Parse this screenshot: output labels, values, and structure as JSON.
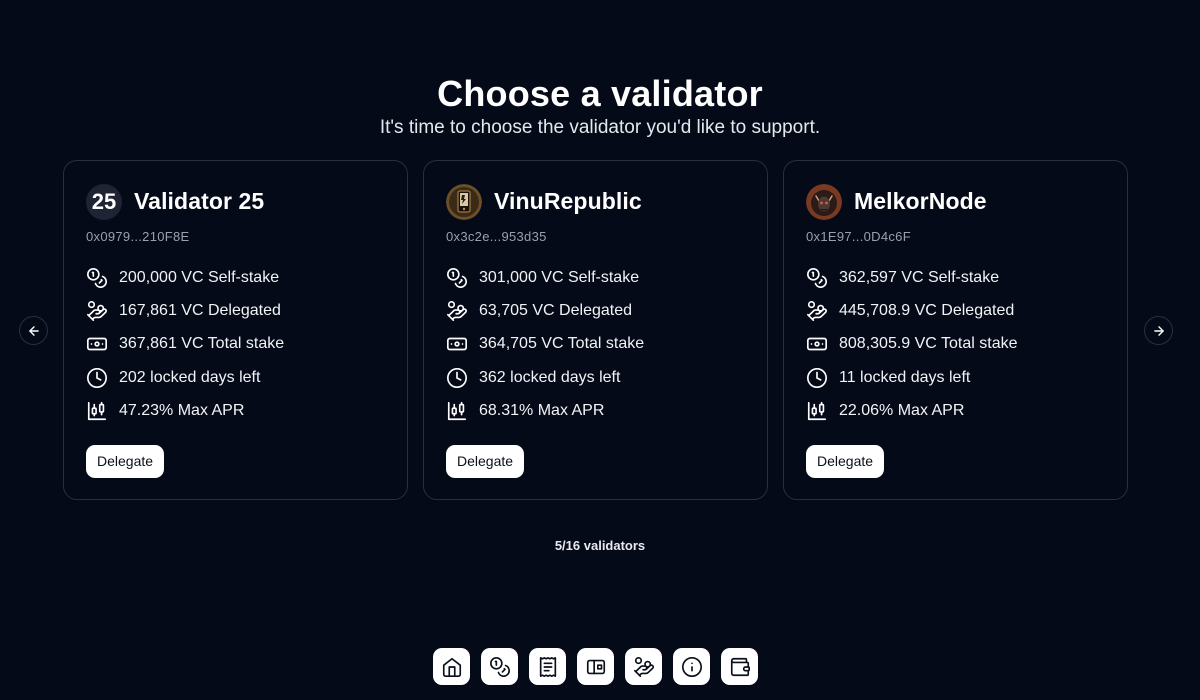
{
  "header": {
    "title": "Choose a validator",
    "subtitle": "It's time to choose the validator you'd like to support."
  },
  "validators": [
    {
      "avatar": "25",
      "avatar_type": "number",
      "name": "Validator 25",
      "address": "0x0979...210F8E",
      "self_stake": "200,000 VC Self-stake",
      "delegated": "167,861 VC Delegated",
      "total_stake": "367,861 VC Total stake",
      "locked_days": "202 locked days left",
      "max_apr": "47.23% Max APR",
      "button": "Delegate"
    },
    {
      "avatar": "",
      "avatar_type": "image",
      "name": "VinuRepublic",
      "address": "0x3c2e...953d35",
      "self_stake": "301,000 VC Self-stake",
      "delegated": "63,705 VC Delegated",
      "total_stake": "364,705 VC Total stake",
      "locked_days": "362 locked days left",
      "max_apr": "68.31% Max APR",
      "button": "Delegate"
    },
    {
      "avatar": "",
      "avatar_type": "image",
      "name": "MelkorNode",
      "address": "0x1E97...0D4c6F",
      "self_stake": "362,597 VC Self-stake",
      "delegated": "445,708.9 VC Delegated",
      "total_stake": "808,305.9 VC Total stake",
      "locked_days": "11 locked days left",
      "max_apr": "22.06% Max APR",
      "button": "Delegate"
    }
  ],
  "icons": {
    "self_stake": "coins-icon",
    "delegated": "hand-coins-icon",
    "total_stake": "banknote-icon",
    "locked_days": "clock-icon",
    "max_apr": "candlestick-chart-icon",
    "prev": "arrow-left-icon",
    "next": "arrow-right-icon"
  },
  "pagination": {
    "counter": "5/16 validators"
  },
  "dock": [
    "home-icon",
    "coins-icon",
    "receipt-icon",
    "wallet-card-icon",
    "hand-coins-icon",
    "info-icon",
    "wallet-icon"
  ],
  "colors": {
    "background": "#050a18",
    "card_border": "#2a2f3d",
    "text": "#ffffff",
    "muted": "#9aa0ad"
  }
}
